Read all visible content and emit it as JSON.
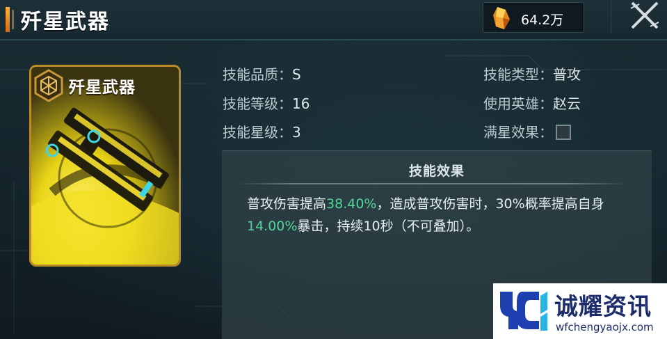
{
  "header": {
    "title": "歼星武器",
    "currency": {
      "icon": "crystal-shard-icon",
      "value": "64.2万"
    },
    "close_icon": "close-icon"
  },
  "card": {
    "badge_icon": "hexagon-emblem-icon",
    "title": "歼星武器"
  },
  "skill_info": {
    "quality_label": "技能品质：",
    "quality_value": "S",
    "level_label": "技能等级：",
    "level_value": "16",
    "star_label": "技能星级：",
    "star_value": "3",
    "type_label": "技能类型：",
    "type_value": "普攻",
    "hero_label": "使用英雄：",
    "hero_value": "赵云",
    "full_star_label": "满星效果：",
    "full_star_checked": false
  },
  "effect": {
    "title": "技能效果",
    "text_1": "普攻伤害提高",
    "value_1": "38.40%",
    "text_2": "，造成普攻伤害时，30%概率提高自身",
    "value_2": "14.00%",
    "text_3": "暴击，持续10秒（不可叠加）。"
  },
  "watermark": {
    "name": "诚耀资讯",
    "url": "wfchengyaojx.com"
  },
  "colors": {
    "highlight": "#52d69a",
    "accent": "#ffb23b",
    "card_border": "#b88a2a",
    "watermark_blue": "#1d2c6b"
  }
}
